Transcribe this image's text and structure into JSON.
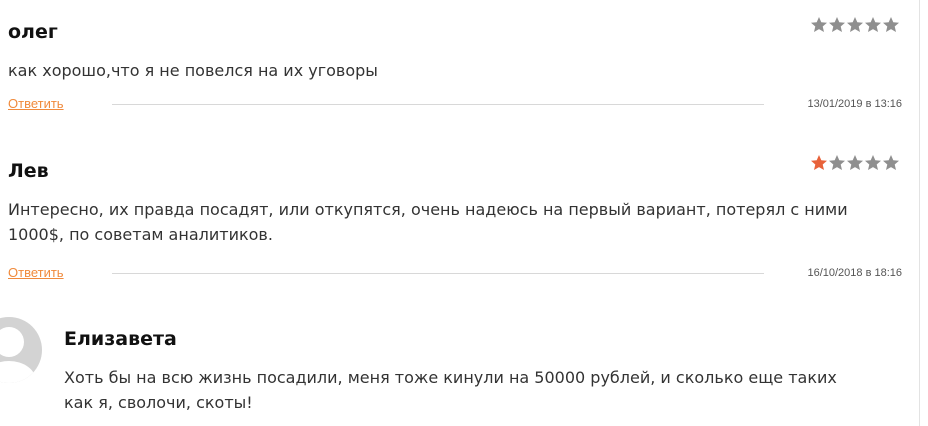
{
  "comments": [
    {
      "author": "олег",
      "rating": 0,
      "text": "как хорошо,что я не повелся на их уговоры",
      "reply_label": "Ответить",
      "date": "13/01/2019 в 13:16"
    },
    {
      "author": "Лев",
      "rating": 1,
      "text": "Интересно, их правда посадят, или откупятся, очень надеюсь на первый вариант, потерял с ними 1000$, по советам аналитиков.",
      "reply_label": "Ответить",
      "date": "16/10/2018 в 18:16"
    }
  ],
  "reply": {
    "author": "Елизавета",
    "text": "Хоть бы на всю жизнь посадили, меня тоже кинули на 50000 рублей, и сколько еще таких как я, сволочи, скоты!"
  },
  "colors": {
    "star_filled": "#e8623a",
    "star_empty": "#8f8f8f",
    "link": "#f08a3c"
  },
  "icons": {
    "star": "star-icon",
    "avatar": "default-avatar-icon"
  }
}
